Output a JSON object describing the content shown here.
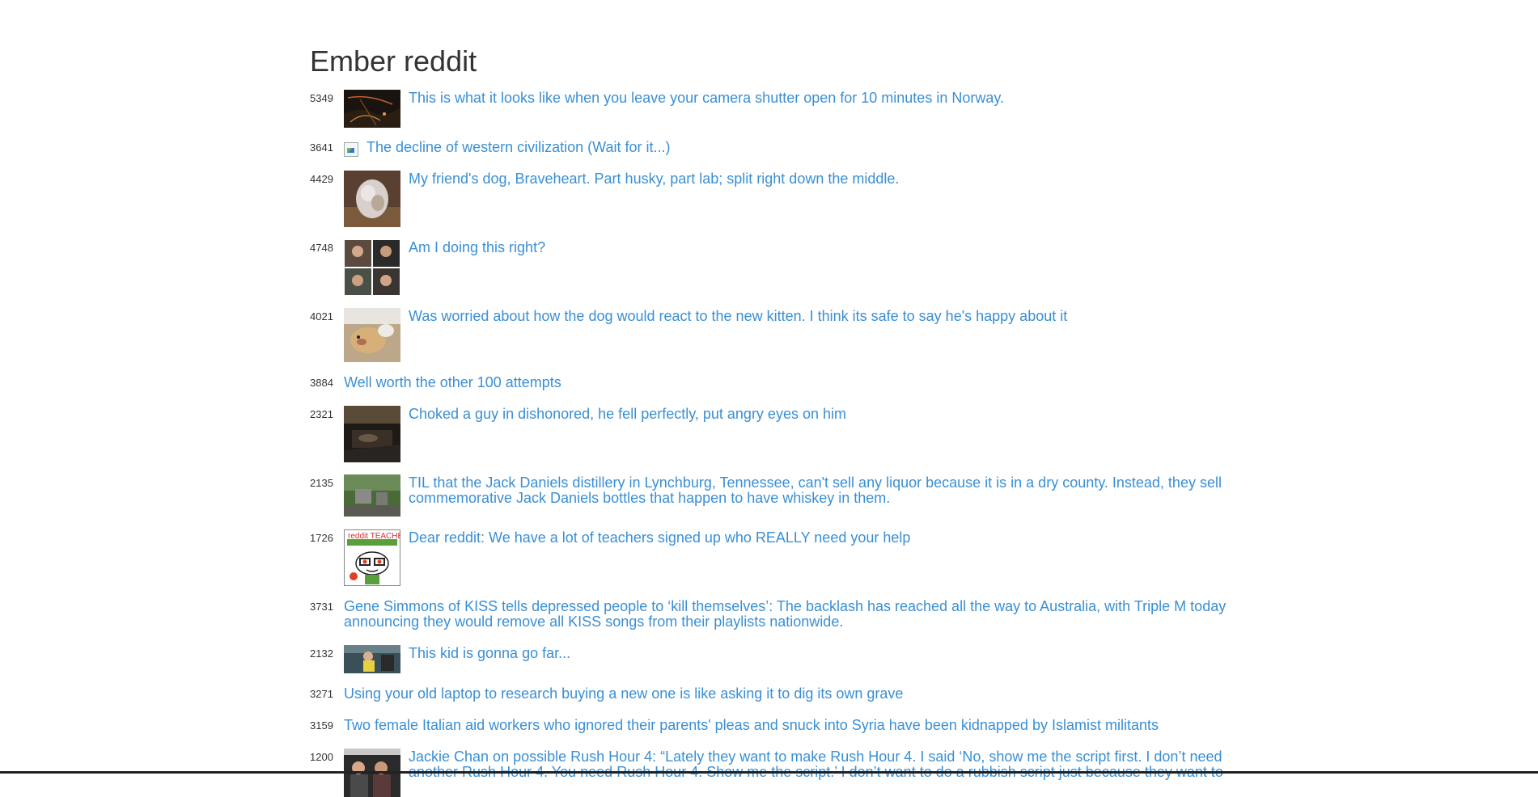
{
  "page": {
    "title": "Ember reddit"
  },
  "posts": [
    {
      "score": "5349",
      "title": "This is what it looks like when you leave your camera shutter open for 10 minutes in Norway.",
      "thumb": "night-sky"
    },
    {
      "score": "3641",
      "title": "The decline of western civilization (Wait for it...)",
      "thumb": "broken"
    },
    {
      "score": "4429",
      "title": "My friend's dog, Braveheart. Part husky, part lab; split right down the middle.",
      "thumb": "dog"
    },
    {
      "score": "4748",
      "title": "Am I doing this right?",
      "thumb": "collage"
    },
    {
      "score": "4021",
      "title": "Was worried about how the dog would react to the new kitten. I think its safe to say he's happy about it",
      "thumb": "dog-kitten"
    },
    {
      "score": "3884",
      "title": "Well worth the other 100 attempts",
      "thumb": "none"
    },
    {
      "score": "2321",
      "title": "Choked a guy in dishonored, he fell perfectly, put angry eyes on him",
      "thumb": "game"
    },
    {
      "score": "2135",
      "title": "TIL that the Jack Daniels distillery in Lynchburg, Tennessee, can't sell any liquor because it is in a dry county. Instead, they sell commemorative Jack Daniels bottles that happen to have whiskey in them.",
      "thumb": "distillery"
    },
    {
      "score": "1726",
      "title": "Dear reddit: We have a lot of teachers signed up who REALLY need your help",
      "thumb": "reddit-teachers",
      "thumb_text": "reddit TEACHERS"
    },
    {
      "score": "3731",
      "title": "Gene Simmons of KISS tells depressed people to ‘kill themselves’: The backlash has reached all the way to Australia, with Triple M today announcing they would remove all KISS songs from their playlists nationwide.",
      "thumb": "none"
    },
    {
      "score": "2132",
      "title": "This kid is gonna go far...",
      "thumb": "kid"
    },
    {
      "score": "3271",
      "title": "Using your old laptop to research buying a new one is like asking it to dig its own grave",
      "thumb": "none"
    },
    {
      "score": "3159",
      "title": "Two female Italian aid workers who ignored their parents' pleas and snuck into Syria have been kidnapped by Islamist militants",
      "thumb": "none"
    },
    {
      "score": "1200",
      "title": "Jackie Chan on possible Rush Hour 4: “Lately they want to make Rush Hour 4. I said ‘No, show me the script first. I don’t need another Rush Hour 4. You need Rush Hour 4. Show me the script.’ I don’t want to do a rubbish script just because they want to",
      "thumb": "jackie"
    }
  ]
}
